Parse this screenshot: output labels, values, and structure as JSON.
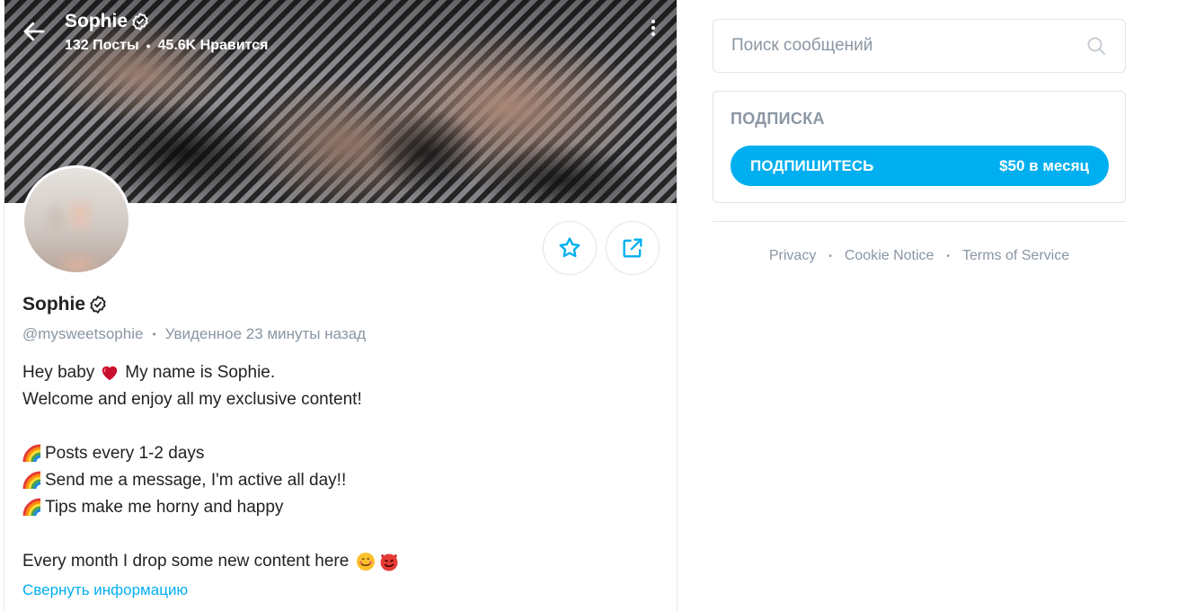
{
  "header": {
    "name": "Sophie",
    "posts": "132 Посты",
    "likes": "45.6K Нравится"
  },
  "profile": {
    "name": "Sophie",
    "username": "@mysweetsophie",
    "last_seen": "Увиденное 23 минуты назад",
    "bio": {
      "line1_a": "Hey baby",
      "line1_b": "My name is Sophie.",
      "line2": "Welcome and enjoy all my exclusive content!",
      "line3": "Posts every 1-2 days",
      "line4": "Send me a message, I'm active all day!!",
      "line5": "Tips make me horny and happy",
      "line6": "Every month I drop some new content here"
    },
    "collapse_label": "Свернуть информацию"
  },
  "search": {
    "placeholder": "Поиск сообщений"
  },
  "subscription": {
    "title": "ПОДПИСКА",
    "button_label": "ПОДПИШИТЕСЬ",
    "price": "$50 в месяц"
  },
  "footer": {
    "privacy": "Privacy",
    "cookie": "Cookie Notice",
    "terms": "Terms of Service"
  },
  "icons": {
    "back": "arrow-left-icon",
    "verified": "verified-badge-icon",
    "more": "more-vertical-icon",
    "star": "star-icon",
    "share": "share-icon",
    "search": "search-icon"
  },
  "colors": {
    "accent": "#00aff0",
    "muted": "#8a96a3",
    "text": "#222222"
  }
}
